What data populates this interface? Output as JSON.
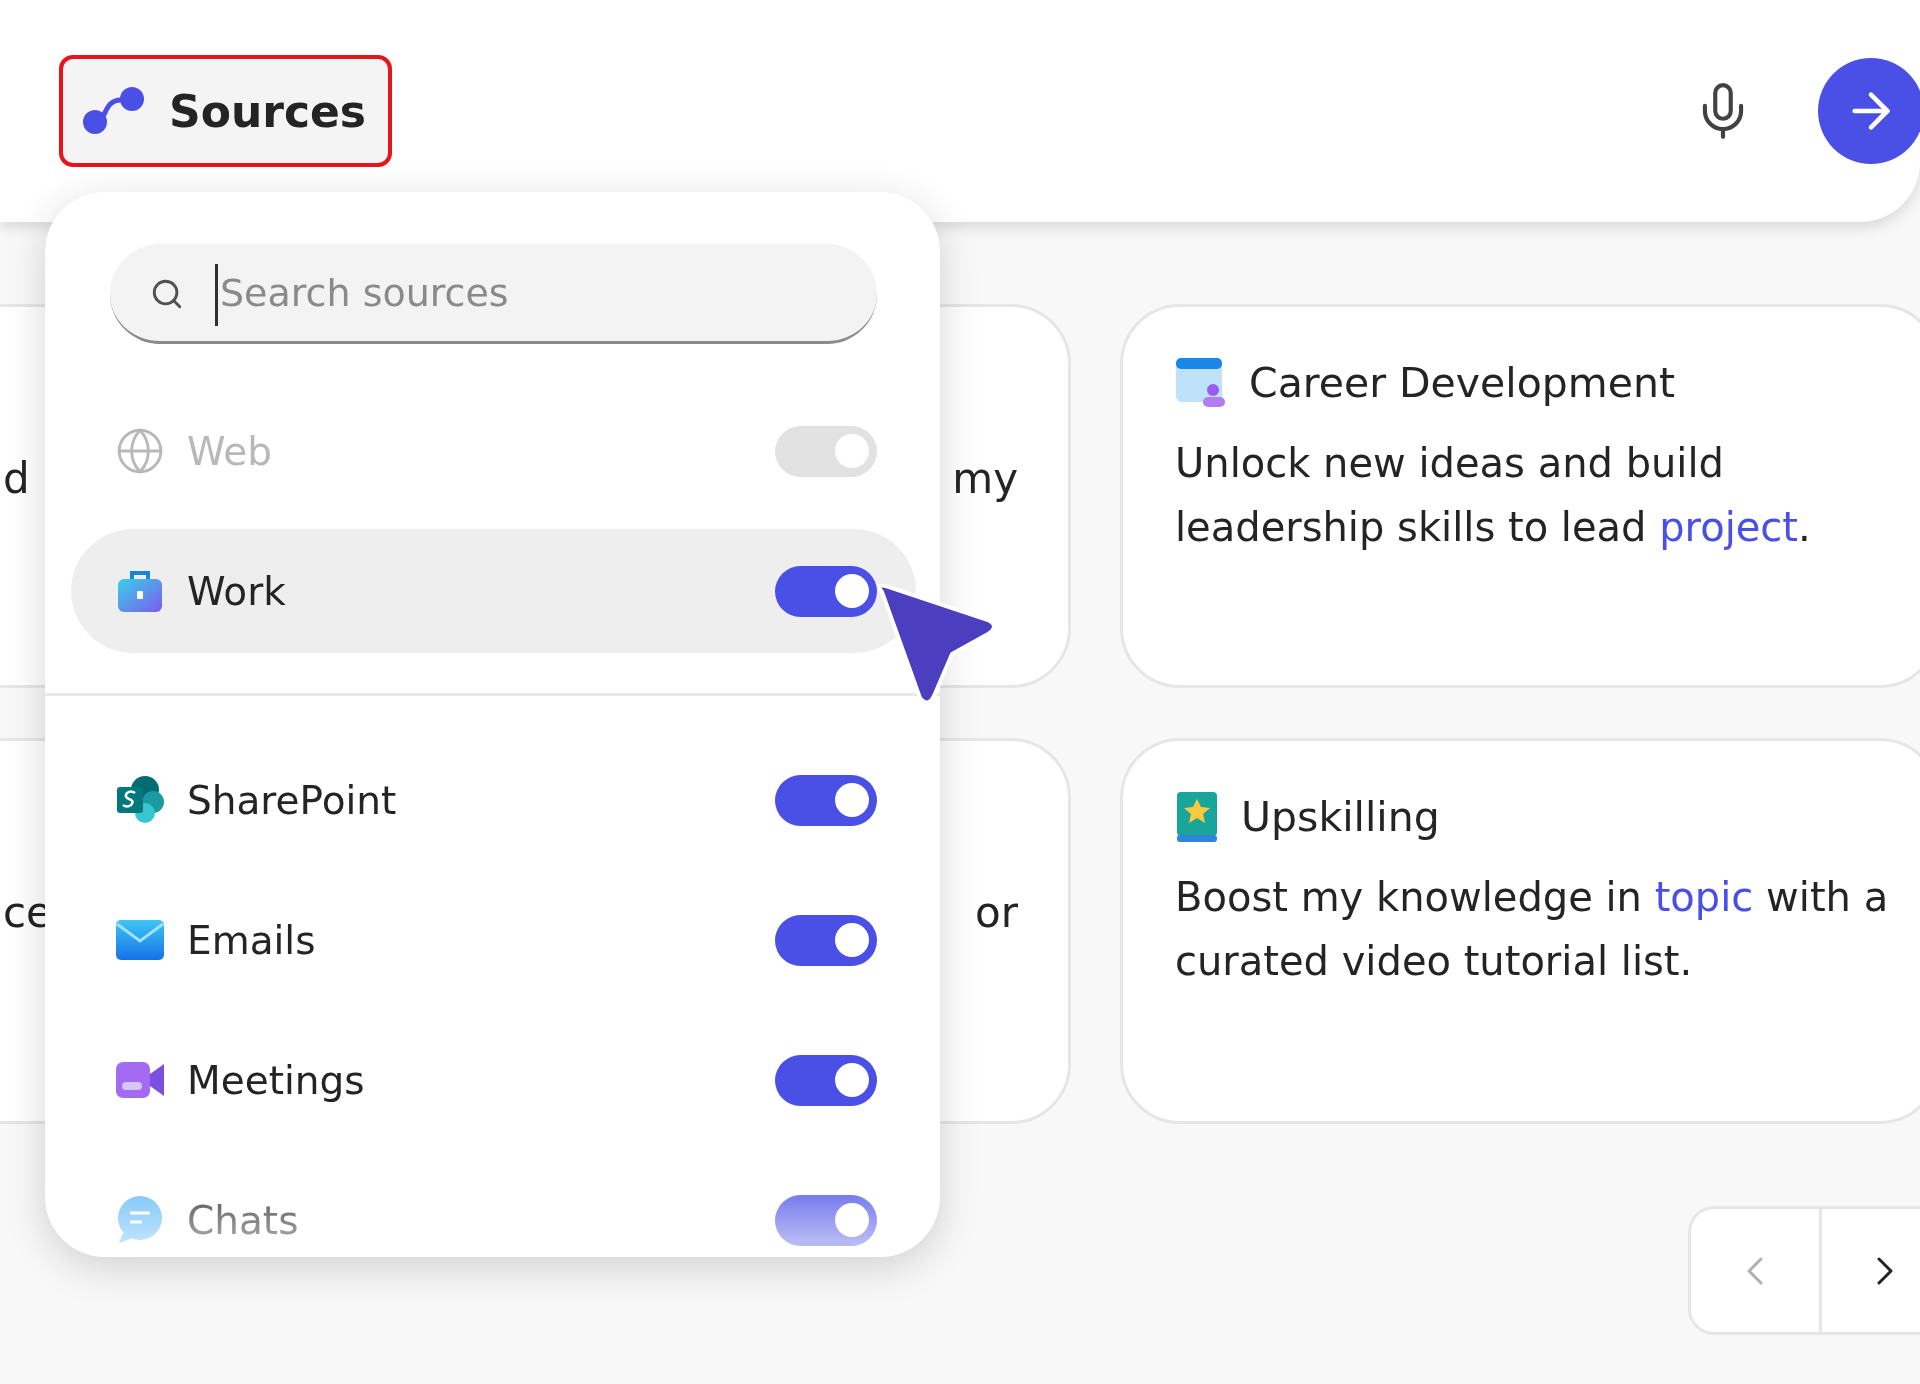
{
  "top_bar": {
    "sources_button": {
      "label": "Sources",
      "highlighted": true
    }
  },
  "sources_menu": {
    "search": {
      "placeholder": "Search sources"
    },
    "items": [
      {
        "label": "Web",
        "on": true,
        "disabled": true,
        "selected": false
      },
      {
        "label": "Work",
        "on": true,
        "disabled": false,
        "selected": true
      },
      {
        "label": "SharePoint",
        "on": true,
        "disabled": false,
        "selected": false
      },
      {
        "label": "Emails",
        "on": true,
        "disabled": false,
        "selected": false
      },
      {
        "label": "Meetings",
        "on": true,
        "disabled": false,
        "selected": false
      },
      {
        "label": "Chats",
        "on": true,
        "disabled": false,
        "selected": false
      }
    ]
  },
  "left_cards": [
    {
      "text_left": "d",
      "text_right": "my"
    },
    {
      "text_left": "ce",
      "text_right": "or"
    }
  ],
  "cards": [
    {
      "title": "Career Development",
      "body": [
        {
          "text": "Unlock new ideas and build leadership skills to lead ",
          "kind": "plain"
        },
        {
          "text": "project",
          "kind": "placeholder"
        },
        {
          "text": ".",
          "kind": "plain"
        }
      ]
    },
    {
      "title": "Upskilling",
      "body": [
        {
          "text": "Boost my knowledge in ",
          "kind": "plain"
        },
        {
          "text": "topic",
          "kind": "placeholder"
        },
        {
          "text": " with a curated video tutorial list.",
          "kind": "plain"
        }
      ]
    }
  ],
  "pager": {
    "prev_disabled": true
  }
}
